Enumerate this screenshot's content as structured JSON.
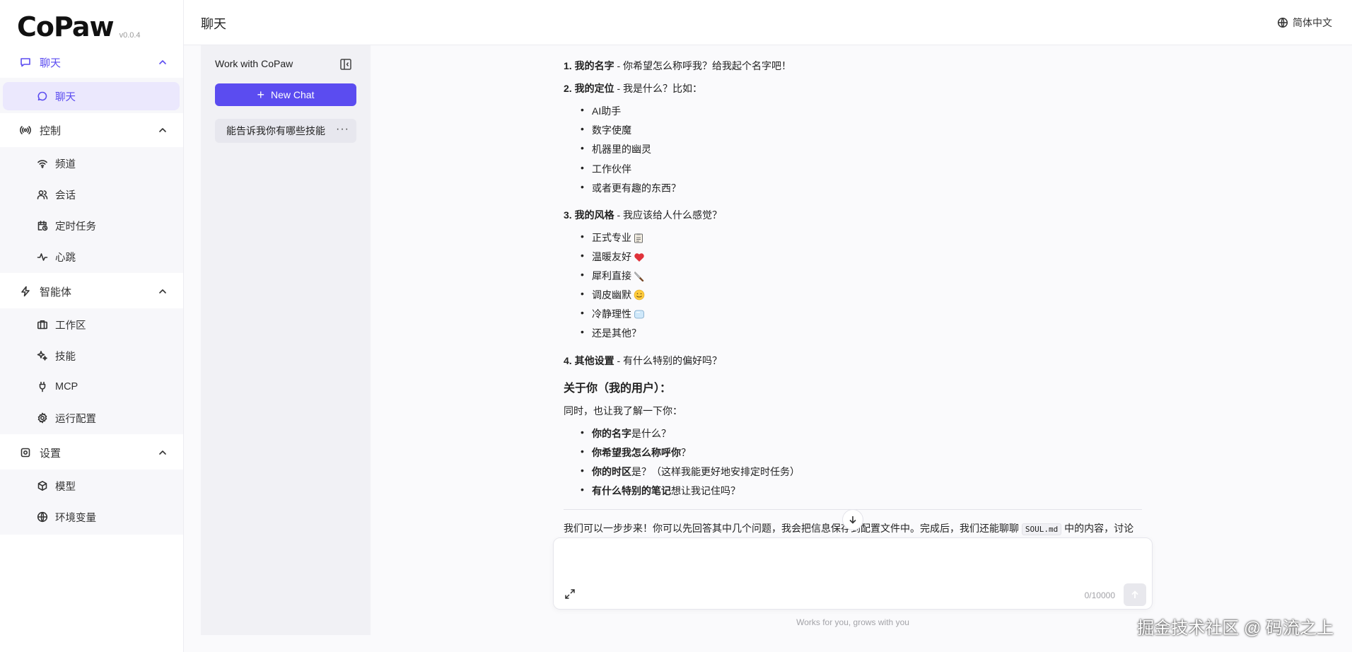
{
  "app": {
    "logo": "CoPaw",
    "version": "v0.0.4"
  },
  "header": {
    "title": "聊天",
    "language": "简体中文"
  },
  "sidebar": {
    "groups": [
      {
        "label": "聊天",
        "items": [
          {
            "label": "聊天"
          }
        ]
      },
      {
        "label": "控制",
        "items": [
          {
            "label": "频道"
          },
          {
            "label": "会话"
          },
          {
            "label": "定时任务"
          },
          {
            "label": "心跳"
          }
        ]
      },
      {
        "label": "智能体",
        "items": [
          {
            "label": "工作区"
          },
          {
            "label": "技能"
          },
          {
            "label": "MCP"
          },
          {
            "label": "运行配置"
          }
        ]
      },
      {
        "label": "设置",
        "items": [
          {
            "label": "模型"
          },
          {
            "label": "环境变量"
          }
        ]
      }
    ]
  },
  "chat_list": {
    "title": "Work with CoPaw",
    "new_chat_label": "New Chat",
    "sessions": [
      {
        "title": "能告诉我你有哪些技能"
      }
    ]
  },
  "message": {
    "q1": {
      "num": "1.",
      "bold": "我的名字",
      "text": " - 你希望怎么称呼我？给我起个名字吧！"
    },
    "q2": {
      "num": "2.",
      "bold": "我的定位",
      "text": " - 我是什么？比如："
    },
    "q2_items": [
      "AI助手",
      "数字使魔",
      "机器里的幽灵",
      "工作伙伴",
      "或者更有趣的东西？"
    ],
    "q3": {
      "num": "3.",
      "bold": "我的风格",
      "text": " - 我应该给人什么感觉？"
    },
    "q3_items": [
      {
        "text": "正式专业",
        "emoji": "clipboard-icon"
      },
      {
        "text": "温暖友好",
        "emoji": "heart-icon"
      },
      {
        "text": "犀利直接",
        "emoji": "knife-icon"
      },
      {
        "text": "调皮幽默",
        "emoji": "smile-icon"
      },
      {
        "text": "冷静理性",
        "emoji": "ice-cube-icon"
      },
      {
        "text": "还是其他？",
        "emoji": ""
      }
    ],
    "q4": {
      "num": "4.",
      "bold": "其他设置",
      "text": " - 有什么特别的偏好吗？"
    },
    "user_heading": "关于你（我的用户）：",
    "user_intro": "同时，也让我了解一下你：",
    "user_items": [
      {
        "bold": "你的名字",
        "text": "是什么？"
      },
      {
        "bold": "你希望我怎么称呼你",
        "text": "？"
      },
      {
        "bold": "你的时区",
        "text": "是？（这样我能更好地安排定时任务）"
      },
      {
        "bold": "有什么特别的笔记",
        "text": "想让我记住吗？"
      }
    ],
    "footer_before": "我们可以一步步来！你可以先回答其中几个问题，我会把信息保存到配置文件中。完成后，我们还能聊聊 ",
    "footer_code": "SOUL.md",
    "footer_after": " 中的内容，讨论"
  },
  "composer": {
    "placeholder": "",
    "counter": "0/10000",
    "tagline": "Works for you, grows with you"
  },
  "watermark": "掘金技术社区 @ 码流之上"
}
